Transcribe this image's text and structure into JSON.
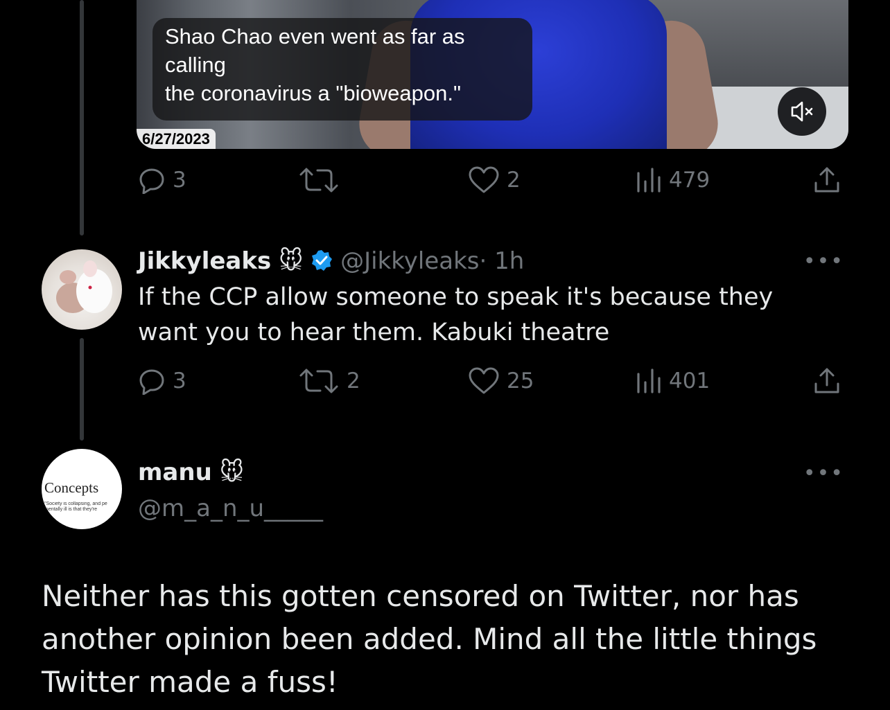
{
  "video": {
    "caption": "Shao Chao even went as far as\ncalling\nthe coronavirus a \"bioweapon.\"",
    "date": "6/27/2023",
    "mute_icon": "speaker-muted-icon"
  },
  "tweet1_actions": {
    "replies": "3",
    "retweets": "",
    "likes": "2",
    "views": "479"
  },
  "reply1": {
    "name": "Jikkyleaks",
    "emoji": "🐭",
    "handle": "@Jikkyleaks",
    "time": "· 1h",
    "text": "If the CCP allow someone to speak it's because they want you to hear them. Kabuki theatre",
    "more": "•••",
    "actions": {
      "replies": "3",
      "retweets": "2",
      "likes": "25",
      "views": "401"
    }
  },
  "main_tweet": {
    "name": "manu",
    "emoji": "🐭",
    "handle": "@m_a_n_u_____",
    "more": "•••",
    "avatar_title": "Concepts",
    "avatar_subtitle": "\"Society is collapsing, and pe mentally ill is that they're",
    "text": "Neither has this gotten censored on Twitter, nor has another opinion been added. Mind all the little things Twitter made a fuss!"
  },
  "colors": {
    "background": "#000000",
    "text": "#e7e9ea",
    "muted": "#71767b",
    "verified": "#1d9bf0"
  }
}
